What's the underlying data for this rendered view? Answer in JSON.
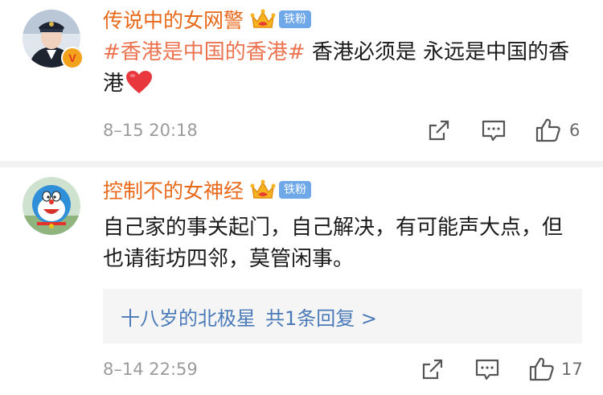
{
  "comments": [
    {
      "username": "传说中的女网警",
      "fan_badge": "铁粉",
      "verified_badge": "V",
      "hashtag": "#香港是中国的香港#",
      "text": " 香港必须是 永远是中国的香港",
      "emoji": "heart",
      "time": "8–15 20:18",
      "likes": "6"
    },
    {
      "username": "控制不的女神经",
      "fan_badge": "铁粉",
      "text": "自己家的事关起门，自己解决，有可能声大点，但也请街坊四邻，莫管闲事。",
      "reply_user": "十八岁的北极星",
      "reply_summary": "共1条回复 >",
      "time": "8–14 22:59",
      "likes": "17"
    }
  ],
  "colors": {
    "username": "#e8681a",
    "hashtag": "#eb7350",
    "reply_link": "#4a7ab8",
    "fan_badge_bg": "#6fa8e8",
    "meta_text": "#9b9b9b"
  },
  "icons": [
    "crown-icon",
    "share-icon",
    "comment-icon",
    "like-icon",
    "heart-emoji",
    "verified-v-icon"
  ]
}
